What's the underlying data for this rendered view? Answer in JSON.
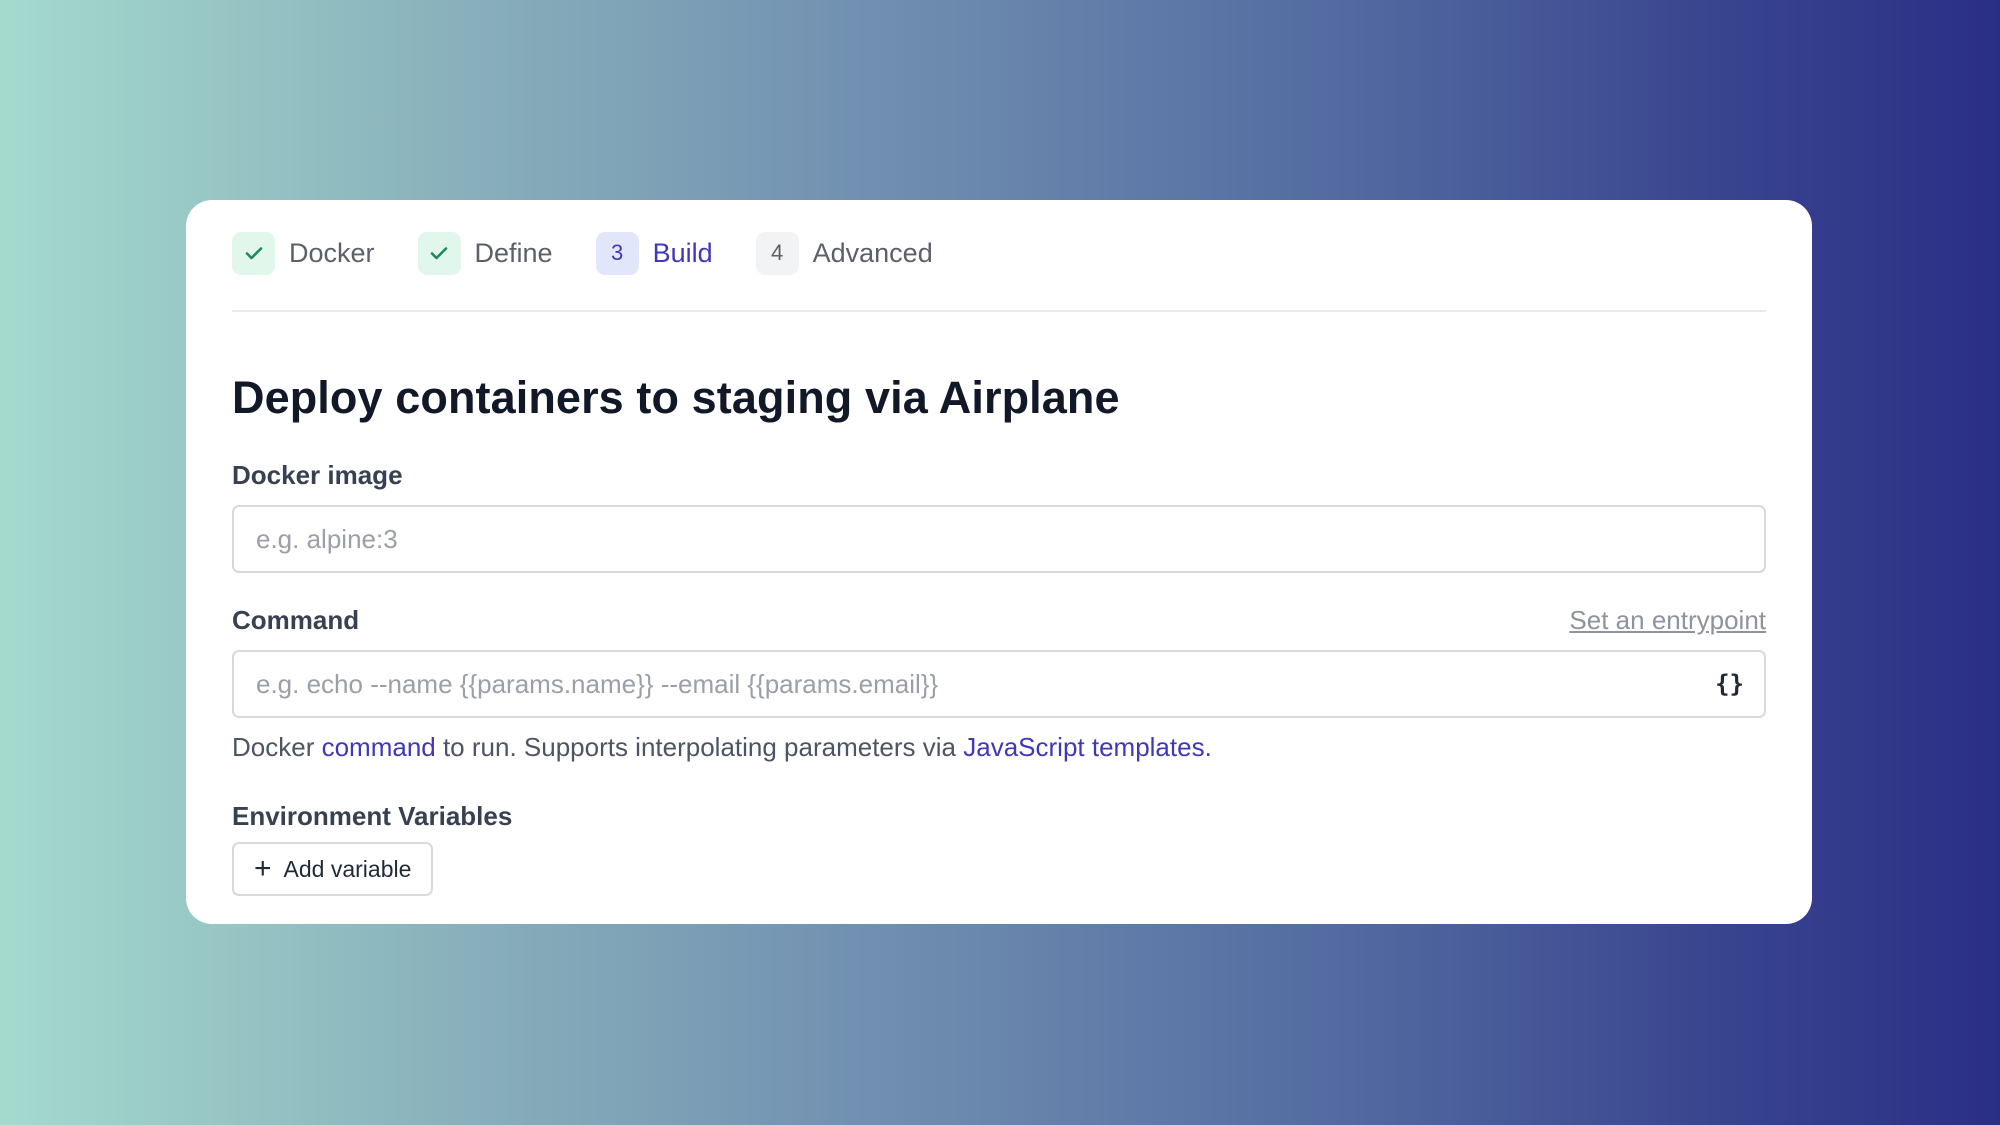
{
  "stepper": {
    "steps": [
      {
        "label": "Docker",
        "status": "done",
        "icon": "check-icon"
      },
      {
        "label": "Define",
        "status": "done",
        "icon": "check-icon"
      },
      {
        "label": "Build",
        "status": "current",
        "number": "3"
      },
      {
        "label": "Advanced",
        "status": "pending",
        "number": "4"
      }
    ]
  },
  "form": {
    "title": "Deploy containers to staging via Airplane",
    "docker_image": {
      "label": "Docker image",
      "placeholder": "e.g. alpine:3",
      "value": ""
    },
    "command": {
      "label": "Command",
      "entrypoint_link": "Set an entrypoint",
      "placeholder": "e.g. echo --name {{params.name}} --email {{params.email}}",
      "value": "",
      "icon": "braces-icon",
      "icon_glyph": "{}",
      "help": {
        "prefix": "Docker ",
        "link1": "command",
        "middle": " to run. Supports interpolating parameters via ",
        "link2": "JavaScript templates",
        "suffix": "."
      }
    },
    "env": {
      "label": "Environment Variables",
      "add_button": "Add variable",
      "add_icon": "plus-icon",
      "add_glyph": "+"
    }
  },
  "colors": {
    "accent": "#3f38b8",
    "done_badge": "#e2f7ec",
    "check": "#1f8a5b"
  }
}
